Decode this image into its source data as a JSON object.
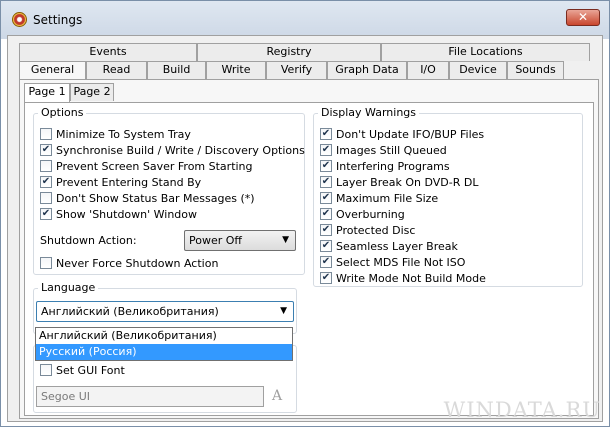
{
  "window": {
    "title": "Settings",
    "close_symbol": "✕"
  },
  "tabs_top": [
    "Events",
    "Registry",
    "File Locations"
  ],
  "tabs_bottom": [
    "General",
    "Read",
    "Build",
    "Write",
    "Verify",
    "Graph Data",
    "I/O",
    "Device",
    "Sounds"
  ],
  "subtabs": [
    "Page 1",
    "Page 2"
  ],
  "options": {
    "title": "Options",
    "items": [
      {
        "label": "Minimize To System Tray",
        "checked": false
      },
      {
        "label": "Synchronise Build / Write / Discovery Options",
        "checked": true
      },
      {
        "label": "Prevent Screen Saver From Starting",
        "checked": false
      },
      {
        "label": "Prevent Entering Stand By",
        "checked": true
      },
      {
        "label": "Don't Show Status Bar Messages (*)",
        "checked": false
      },
      {
        "label": "Show 'Shutdown' Window",
        "checked": true
      }
    ],
    "shutdown_label": "Shutdown Action:",
    "shutdown_value": "Power Off",
    "never_force": {
      "label": "Never Force Shutdown Action",
      "checked": false
    }
  },
  "language": {
    "title": "Language",
    "selected": "Английский (Великобритания)",
    "options": [
      "Английский (Великобритания)",
      "Русский (Россия)"
    ],
    "highlighted": "Русский (Россия)"
  },
  "font": {
    "set_gui_font": {
      "label": "Set GUI Font",
      "checked": false
    },
    "value": "Segoe UI",
    "icon_glyph": "A"
  },
  "display_warnings": {
    "title": "Display Warnings",
    "items": [
      {
        "label": "Don't Update IFO/BUP Files",
        "checked": true
      },
      {
        "label": "Images Still Queued",
        "checked": true
      },
      {
        "label": "Interfering Programs",
        "checked": true
      },
      {
        "label": "Layer Break On DVD-R DL",
        "checked": true
      },
      {
        "label": "Maximum File Size",
        "checked": true
      },
      {
        "label": "Overburning",
        "checked": true
      },
      {
        "label": "Protected Disc",
        "checked": true
      },
      {
        "label": "Seamless Layer Break",
        "checked": true
      },
      {
        "label": "Select MDS File Not ISO",
        "checked": true
      },
      {
        "label": "Write Mode Not Build Mode",
        "checked": true
      }
    ]
  },
  "watermark": "WINDATA.RU",
  "checkmark": "✔",
  "arrow": "▼"
}
